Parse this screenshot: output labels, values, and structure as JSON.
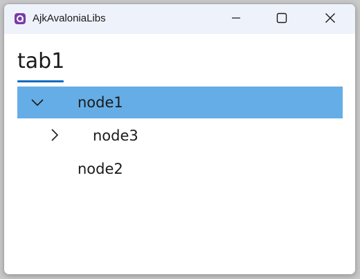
{
  "window": {
    "title": "AjkAvaloniaLibs"
  },
  "tabs": [
    {
      "label": "tab1"
    }
  ],
  "tree": {
    "nodes": [
      {
        "label": "node1",
        "expanded": true,
        "selected": true
      },
      {
        "label": "node3",
        "expanded": false,
        "selected": false
      },
      {
        "label": "node2",
        "selected": false
      }
    ]
  },
  "colors": {
    "titlebar": "#eef2fa",
    "selection": "#65ade6",
    "tab_underline": "#0a6cc2",
    "app_icon": "#7a3aa8"
  },
  "icons": {
    "app": "avalonia-logo-icon",
    "minimize": "minimize-icon",
    "maximize": "maximize-icon",
    "close": "close-icon",
    "expanded": "chevron-down-icon",
    "collapsed": "chevron-right-icon"
  }
}
